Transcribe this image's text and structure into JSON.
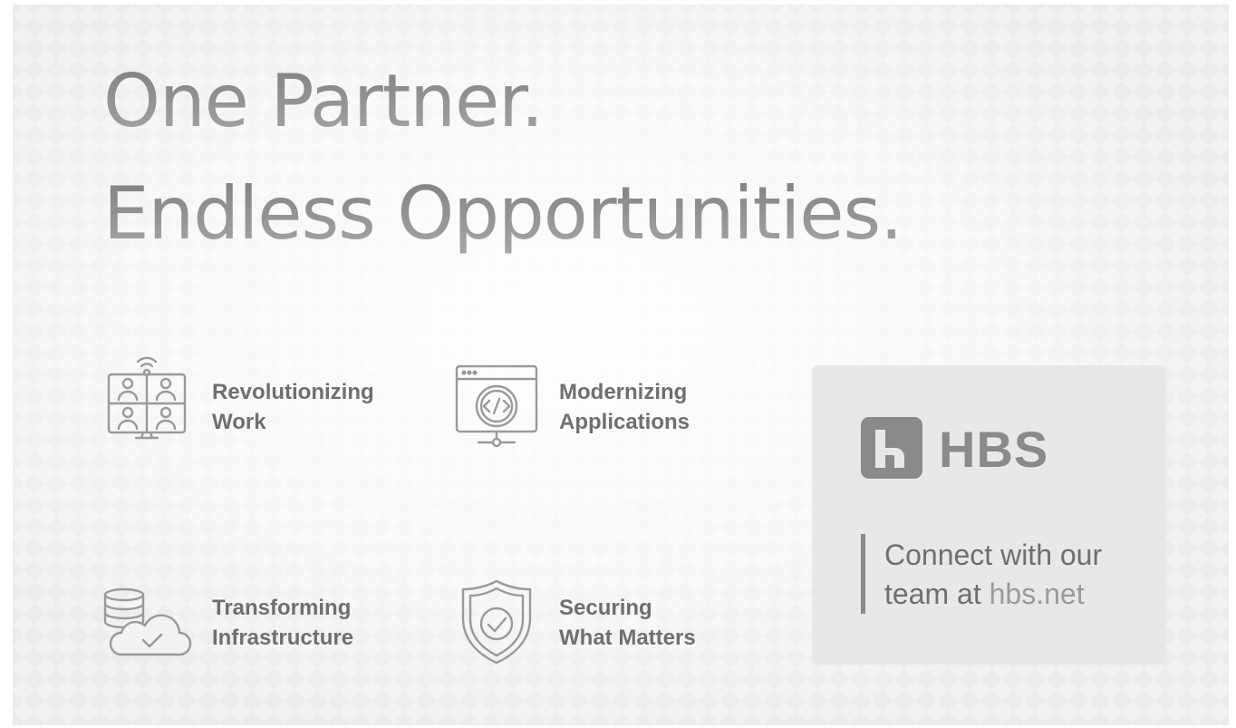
{
  "headline": {
    "line1": "One Partner.",
    "line2": "Endless Opportunities."
  },
  "features": [
    {
      "icon": "video-conference-icon",
      "line1": "Revolutionizing",
      "line2": "Work"
    },
    {
      "icon": "code-window-icon",
      "line1": "Modernizing",
      "line2": "Applications"
    },
    {
      "icon": "cloud-database-icon",
      "line1": "Transforming",
      "line2": "Infrastructure"
    },
    {
      "icon": "shield-check-icon",
      "line1": "Securing",
      "line2": "What Matters"
    }
  ],
  "card": {
    "logo_text": "HBS",
    "cta_line1": "Connect with our",
    "cta_line2_prefix": "team at ",
    "cta_link": "hbs.net"
  },
  "colors": {
    "background": "#f2f2f2",
    "text": "#6f6f6f",
    "icon": "#9a9a9a",
    "card": "#e8e8e8"
  }
}
